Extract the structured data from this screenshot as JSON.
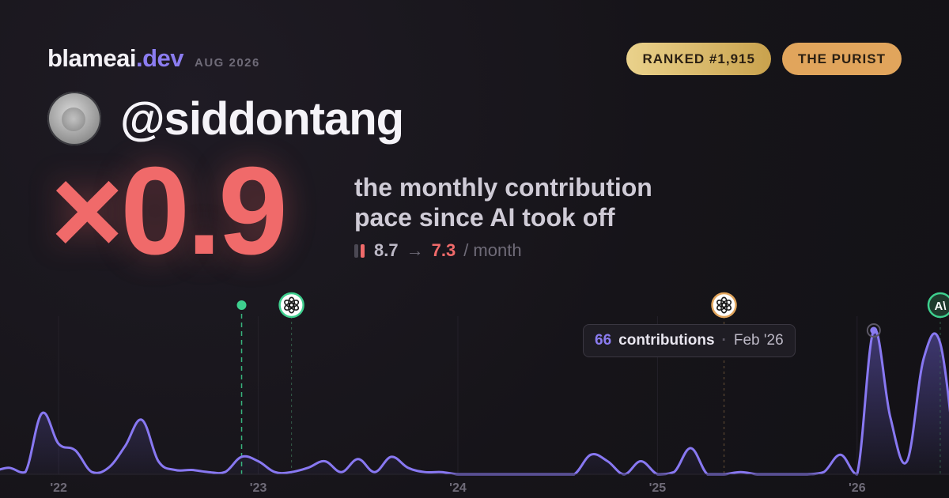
{
  "brand": {
    "name": "blameai",
    "tld": ".dev",
    "date": "AUG 2026"
  },
  "badges": {
    "rank": "RANKED #1,915",
    "title": "THE PURIST"
  },
  "user": {
    "handle": "@siddontang"
  },
  "stats": {
    "multiplier": "×0.9",
    "description_line1": "the monthly contribution",
    "description_line2": "pace since AI took off",
    "before": "8.7",
    "arrow": "→",
    "after": "7.3",
    "unit": "/ month"
  },
  "tooltip": {
    "count": "66",
    "label": "contributions",
    "separator": "·",
    "date": "Feb '26"
  },
  "colors": {
    "accent": "#8b7cf0",
    "multiplier": "#f06a6a",
    "rank_badge": "#d9b86a",
    "title_badge": "#e1a55c",
    "marker_green": "#3ecf8e",
    "marker_orange": "#e1a55c"
  },
  "chart_data": {
    "type": "area",
    "x_ticks": [
      "'22",
      "'23",
      "'24",
      "'25",
      "'26"
    ],
    "markers": [
      {
        "name": "dot-marker",
        "icon": "green-dot-icon",
        "month": "2022-12"
      },
      {
        "name": "openai-marker-1",
        "icon": "openai-icon",
        "month": "2023-03"
      },
      {
        "name": "openai-marker-2",
        "icon": "openai-icon",
        "month": "2025-05"
      },
      {
        "name": "anthropic-marker",
        "icon": "anthropic-icon",
        "month": "2026-06"
      }
    ],
    "highlight": {
      "month": "2026-02",
      "value": 66
    },
    "months": [
      "2021-09",
      "2021-10",
      "2021-11",
      "2021-12",
      "2022-01",
      "2022-02",
      "2022-03",
      "2022-04",
      "2022-05",
      "2022-06",
      "2022-07",
      "2022-08",
      "2022-09",
      "2022-10",
      "2022-11",
      "2022-12",
      "2023-01",
      "2023-02",
      "2023-03",
      "2023-04",
      "2023-05",
      "2023-06",
      "2023-07",
      "2023-08",
      "2023-09",
      "2023-10",
      "2023-11",
      "2023-12",
      "2024-01",
      "2024-02",
      "2024-03",
      "2024-04",
      "2024-05",
      "2024-06",
      "2024-07",
      "2024-08",
      "2024-09",
      "2024-10",
      "2024-11",
      "2024-12",
      "2025-01",
      "2025-02",
      "2025-03",
      "2025-04",
      "2025-05",
      "2025-06",
      "2025-07",
      "2025-08",
      "2025-09",
      "2025-10",
      "2025-11",
      "2025-12",
      "2026-01",
      "2026-02",
      "2026-03",
      "2026-04",
      "2026-05",
      "2026-06",
      "2026-07"
    ],
    "values": [
      1,
      3,
      1,
      28,
      14,
      11,
      1,
      3,
      13,
      25,
      6,
      2,
      2,
      1,
      1,
      8,
      6,
      1,
      1,
      3,
      6,
      1,
      7,
      1,
      8,
      3,
      1,
      1,
      0,
      0,
      0,
      0,
      0,
      0,
      0,
      0,
      9,
      6,
      0,
      6,
      0,
      1,
      12,
      0,
      0,
      1,
      0,
      0,
      0,
      0,
      1,
      9,
      0,
      66,
      26,
      6,
      53,
      60,
      0
    ]
  }
}
